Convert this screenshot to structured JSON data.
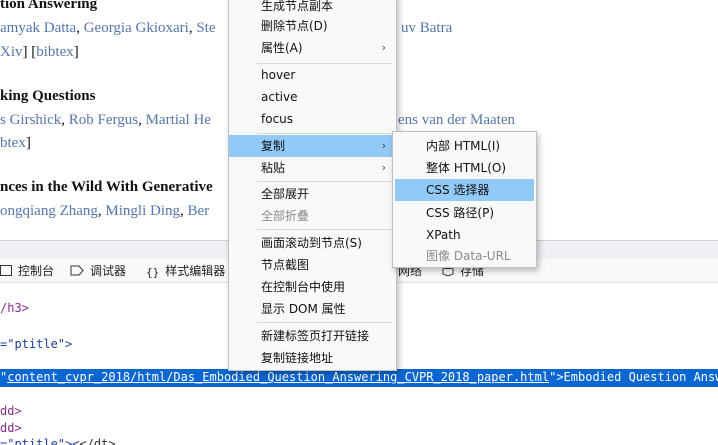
{
  "page": {
    "entry1": {
      "title": "tion Answering",
      "authors": [
        {
          "text": "amyak Datta",
          "link": true
        },
        {
          "text": ", ",
          "link": false
        },
        {
          "text": "Georgia Gkioxari",
          "link": true
        },
        {
          "text": ", ",
          "link": false
        },
        {
          "text": "Ste",
          "link": true
        }
      ],
      "authors_tail": "uv Batra",
      "links_prefix": "Xiv",
      "links_mid": "] [",
      "links_bibtex": "bibtex",
      "links_suffix": "]"
    },
    "entry2": {
      "title": "king Questions",
      "authors": [
        {
          "text": "s Girshick",
          "link": true
        },
        {
          "text": ", ",
          "link": false
        },
        {
          "text": "Rob Fergus",
          "link": true
        },
        {
          "text": ", ",
          "link": false
        },
        {
          "text": "Martial He",
          "link": true
        }
      ],
      "authors_tail": "ens van der Maaten",
      "links_bibtex": "btex",
      "links_suffix": "]"
    },
    "entry3": {
      "title": "nces in the Wild With Generative",
      "authors": [
        {
          "text": "ongqiang Zhang",
          "link": true
        },
        {
          "text": ", ",
          "link": false
        },
        {
          "text": "Mingli Ding",
          "link": true
        },
        {
          "text": ", ",
          "link": false
        },
        {
          "text": "Ber",
          "link": true
        }
      ]
    }
  },
  "devtools": {
    "tabs": [
      {
        "label": "控制台",
        "icon": "console-icon"
      },
      {
        "label": "调试器",
        "icon": "debugger-icon"
      },
      {
        "label": "样式编辑器",
        "icon": "style-editor-icon"
      },
      {
        "label": "网络",
        "icon": "network-icon"
      },
      {
        "label": "存储",
        "icon": "storage-icon"
      }
    ],
    "code": {
      "line0": "/h3>",
      "line1_attr": "=\"ptitle\">",
      "selected_prefix": "\"",
      "selected_href": "content_cvpr_2018/html/Das_Embodied_Question_Answering_CVPR_2018_paper.html",
      "selected_suffix": "\">Embodied Question Answer",
      "line3": "dd>",
      "line4": "dd>",
      "line5_attr": "=\"ptitle\"><",
      "line5_tail": "</dt>"
    }
  },
  "context_menu": {
    "items_top": [
      {
        "label": "生成节点副本",
        "disabled": false
      },
      {
        "label": "删除节点(D)",
        "disabled": false
      },
      {
        "label": "属性(A)",
        "disabled": false,
        "submenu": true
      }
    ],
    "items_pseudo": [
      {
        "label": "hover"
      },
      {
        "label": "active"
      },
      {
        "label": "focus"
      }
    ],
    "items_copy": [
      {
        "label": "复制",
        "submenu": true,
        "highlighted": true
      },
      {
        "label": "粘贴",
        "submenu": true
      }
    ],
    "items_expand": [
      {
        "label": "全部展开",
        "disabled": false
      },
      {
        "label": "全部折叠",
        "disabled": true
      }
    ],
    "items_node": [
      {
        "label": "画面滚动到节点(S)"
      },
      {
        "label": "节点截图"
      },
      {
        "label": "在控制台中使用"
      },
      {
        "label": "显示 DOM 属性"
      }
    ],
    "items_link": [
      {
        "label": "新建标签页打开链接"
      },
      {
        "label": "复制链接地址"
      }
    ]
  },
  "copy_submenu": {
    "items": [
      {
        "label": "内部 HTML(I)",
        "disabled": false,
        "highlighted": false
      },
      {
        "label": "整体 HTML(O)",
        "disabled": false,
        "highlighted": false
      },
      {
        "label": "CSS 选择器",
        "disabled": false,
        "highlighted": true
      },
      {
        "label": "CSS 路径(P)",
        "disabled": false,
        "highlighted": false
      },
      {
        "label": "XPath",
        "disabled": false,
        "highlighted": false
      },
      {
        "label": "图像 Data-URL",
        "disabled": true,
        "highlighted": false
      }
    ]
  },
  "colors": {
    "link": "#5577aa",
    "menu_highlight": "#91c9f7",
    "selection": "#0a66d1"
  }
}
